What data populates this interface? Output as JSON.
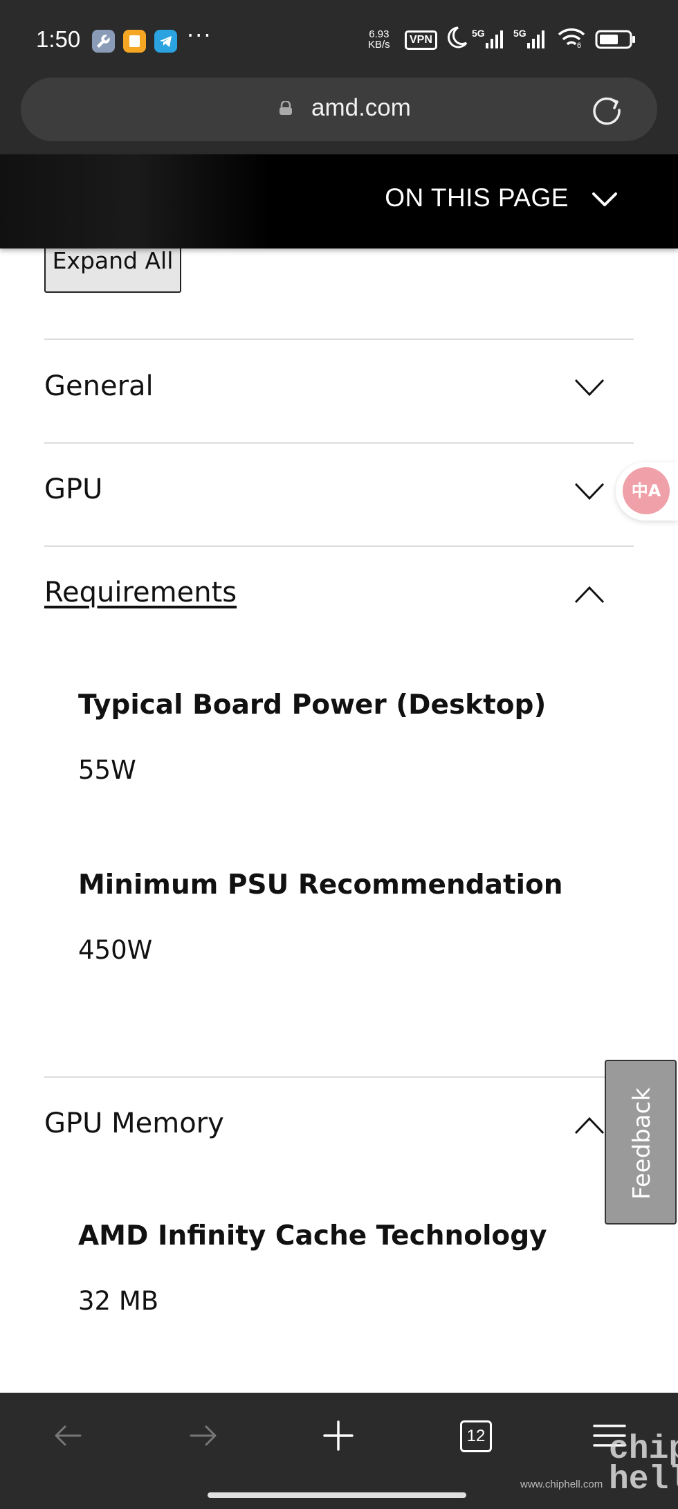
{
  "status_bar": {
    "time": "1:50",
    "more": "···",
    "speed_value": "6.93",
    "speed_unit": "KB/s",
    "vpn": "VPN",
    "net1": "5G",
    "net2": "5G",
    "wifi_badge": "6"
  },
  "browser": {
    "url": "amd.com"
  },
  "on_this_page": {
    "label": "ON THIS PAGE"
  },
  "content": {
    "expand_all": "Expand All",
    "sections": [
      {
        "title": "General"
      },
      {
        "title": "GPU"
      },
      {
        "title": "Requirements"
      },
      {
        "title": "GPU Memory"
      }
    ],
    "requirements": [
      {
        "label": "Typical Board Power (Desktop)",
        "value": "55W"
      },
      {
        "label": "Minimum PSU Recommendation",
        "value": "450W"
      }
    ],
    "gpu_memory": [
      {
        "label": "AMD Infinity Cache Technology",
        "value": "32 MB"
      }
    ]
  },
  "translate_button": {
    "label": "中A"
  },
  "feedback": {
    "label": "Feedback"
  },
  "bottom_nav": {
    "tab_count": "12"
  },
  "watermark": {
    "site": "www.chiphell.com",
    "logo": "chip hell"
  }
}
